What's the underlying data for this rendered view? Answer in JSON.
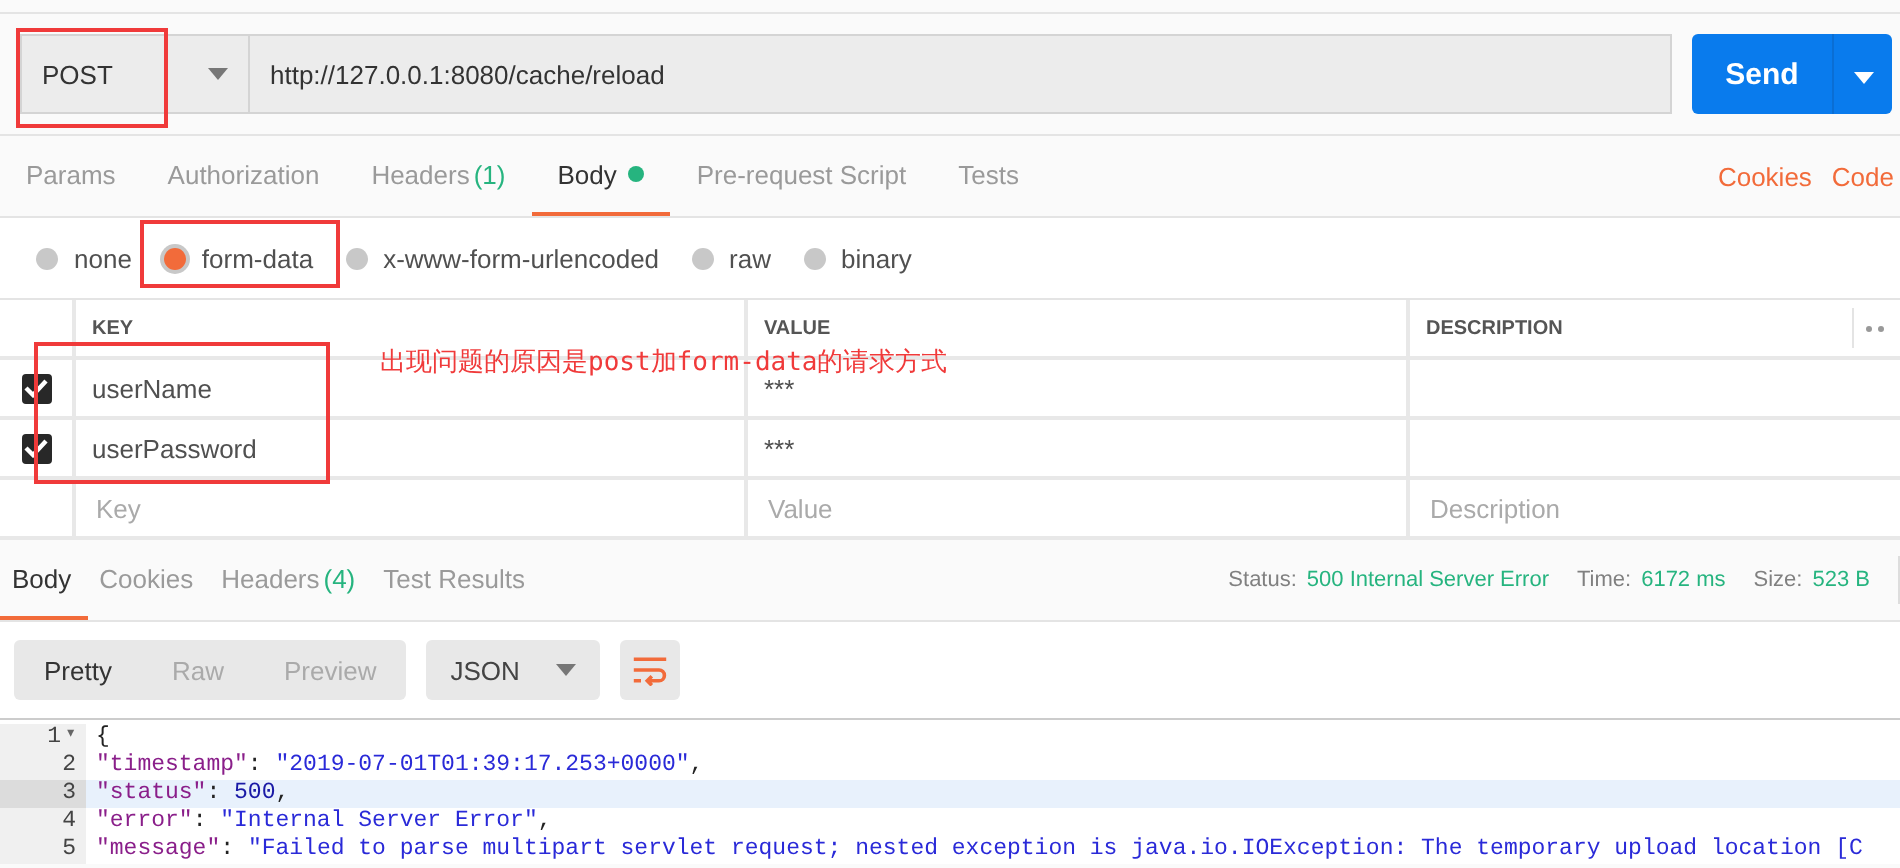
{
  "request": {
    "method": "POST",
    "url": "http://127.0.0.1:8080/cache/reload",
    "send_label": "Send"
  },
  "request_tabs": [
    {
      "label": "Params",
      "selected": false
    },
    {
      "label": "Authorization",
      "selected": false
    },
    {
      "label": "Headers",
      "count": "(1)",
      "selected": false
    },
    {
      "label": "Body",
      "dot": true,
      "selected": true
    },
    {
      "label": "Pre-request Script",
      "selected": false
    },
    {
      "label": "Tests",
      "selected": false
    }
  ],
  "request_links": [
    "Cookies",
    "Code"
  ],
  "body_types": [
    {
      "label": "none",
      "selected": false
    },
    {
      "label": "form-data",
      "selected": true
    },
    {
      "label": "x-www-form-urlencoded",
      "selected": false
    },
    {
      "label": "raw",
      "selected": false
    },
    {
      "label": "binary",
      "selected": false
    }
  ],
  "params_table": {
    "columns": [
      "KEY",
      "VALUE",
      "DESCRIPTION"
    ],
    "rows": [
      {
        "key": "userName",
        "value": "***",
        "checked": true
      },
      {
        "key": "userPassword",
        "value": "***",
        "checked": true
      }
    ],
    "new_row": {
      "key_placeholder": "Key",
      "value_placeholder": "Value",
      "description_placeholder": "Description"
    }
  },
  "annotation": "出现问题的原因是post加form-data的请求方式",
  "response_tabs": [
    {
      "label": "Body",
      "selected": true
    },
    {
      "label": "Cookies",
      "selected": false
    },
    {
      "label": "Headers",
      "count": "(4)",
      "selected": false
    },
    {
      "label": "Test Results",
      "selected": false
    }
  ],
  "response_meta": [
    {
      "label": "Status:",
      "value": "500 Internal Server Error"
    },
    {
      "label": "Time:",
      "value": "6172 ms"
    },
    {
      "label": "Size:",
      "value": "523 B"
    }
  ],
  "view_modes": [
    {
      "label": "Pretty",
      "selected": true
    },
    {
      "label": "Raw",
      "selected": false
    },
    {
      "label": "Preview",
      "selected": false
    }
  ],
  "format": "JSON",
  "code_lines": [
    {
      "number": "1",
      "fold": "▾",
      "selected": false,
      "tokens": [
        {
          "kind": "punct",
          "text": "{"
        }
      ]
    },
    {
      "number": "2",
      "selected": false,
      "tokens": [
        {
          "kind": "key",
          "text": "\"timestamp\""
        },
        {
          "kind": "punct",
          "text": ": "
        },
        {
          "kind": "string",
          "text": "\"2019-07-01T01:39:17.253+0000\""
        },
        {
          "kind": "punct",
          "text": ","
        }
      ]
    },
    {
      "number": "3",
      "selected": true,
      "tokens": [
        {
          "kind": "key",
          "text": "\"status\""
        },
        {
          "kind": "punct",
          "text": ": "
        },
        {
          "kind": "number",
          "text": "500"
        },
        {
          "kind": "punct",
          "text": ","
        }
      ]
    },
    {
      "number": "4",
      "selected": false,
      "tokens": [
        {
          "kind": "key",
          "text": "\"error\""
        },
        {
          "kind": "punct",
          "text": ": "
        },
        {
          "kind": "string",
          "text": "\"Internal Server Error\""
        },
        {
          "kind": "punct",
          "text": ","
        }
      ]
    },
    {
      "number": "5",
      "selected": false,
      "tokens": [
        {
          "kind": "key",
          "text": "\"message\""
        },
        {
          "kind": "punct",
          "text": ": "
        },
        {
          "kind": "string",
          "text": "\"Failed to parse multipart servlet request; nested exception is java.io.IOException: The temporary upload location [C"
        }
      ]
    }
  ]
}
